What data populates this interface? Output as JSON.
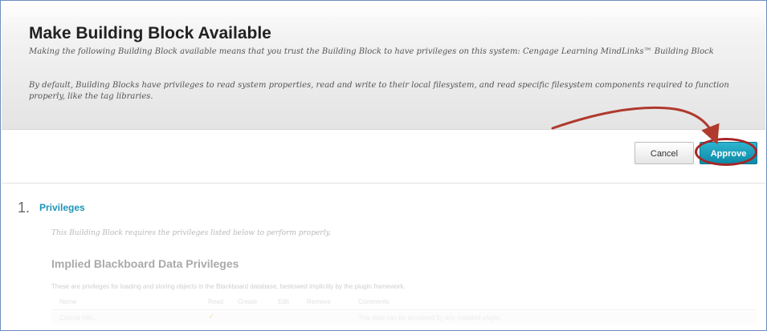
{
  "header": {
    "title": "Make Building Block Available",
    "description1": "Making the following Building Block available means that you trust the Building Block to have privileges on this system: Cengage Learning MindLinks™ Building Block",
    "description2": "By default, Building Blocks have privileges to read system properties, read and write to their local filesystem, and read specific filesystem components required to function properly, like the tag libraries."
  },
  "actions": {
    "cancel_label": "Cancel",
    "approve_label": "Approve"
  },
  "step": {
    "number": "1.",
    "title": "Privileges",
    "description": "This Building Block requires the privileges listed below to perform properly."
  },
  "implied": {
    "title": "Implied Blackboard Data Privileges",
    "description": "These are privileges for loading and storing objects in the Blackboard database, bestowed implicitly by the plugin framework.",
    "columns": [
      "Name",
      "Read",
      "Create",
      "Edit",
      "Remove",
      "Comments"
    ],
    "rows": [
      {
        "name": "Course Info...",
        "read_icon": "check-icon",
        "comments": "This data can be accessed by any installed plugin."
      }
    ]
  },
  "colors": {
    "accent": "#1d94b7",
    "approve_button": "#1aa3c2",
    "annotation": "#a52526"
  }
}
